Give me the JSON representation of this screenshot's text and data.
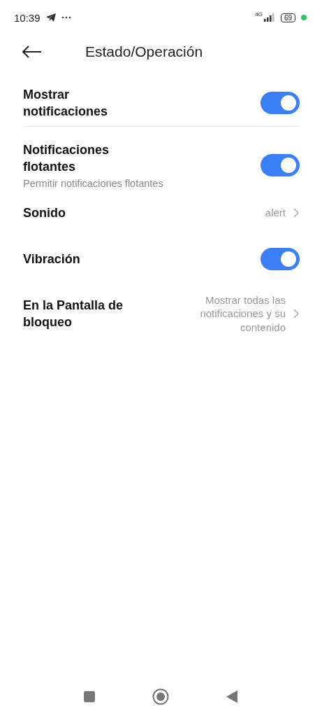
{
  "status_bar": {
    "time": "10:39",
    "network": "4G",
    "battery": "69"
  },
  "header": {
    "title": "Estado/Operación"
  },
  "sections": [
    {
      "items": [
        {
          "kind": "toggle",
          "label": "Mostrar notificaciones",
          "on": true
        }
      ]
    },
    {
      "items": [
        {
          "kind": "toggle",
          "label": "Notificaciones flotantes",
          "subtitle": "Permitir notificaciones flotantes",
          "on": true
        },
        {
          "kind": "link",
          "label": "Sonido",
          "value": "alert"
        },
        {
          "kind": "toggle",
          "label": "Vibración",
          "on": true
        },
        {
          "kind": "link",
          "label": "En la Pantalla de bloqueo",
          "value": "Mostrar todas las notificaciones y su contenido"
        }
      ]
    }
  ]
}
